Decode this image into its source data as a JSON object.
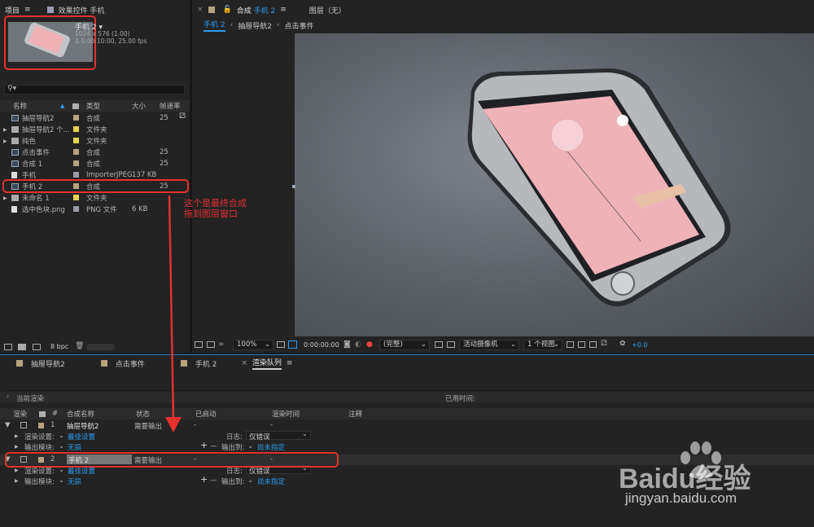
{
  "project_panel": {
    "tab_project": "项目",
    "tab_effects": "效果控件 手机",
    "thumb_name": "手机 2",
    "thumb_size": "1024 x 576 (1.00)",
    "thumb_time": "Δ 0:00:10:00, 25.00 fps",
    "search_placeholder": "",
    "columns": {
      "name": "名称",
      "type": "类型",
      "size": "大小",
      "fps": "帧速率"
    },
    "items": [
      {
        "name": "抽屉导航2",
        "type": "合成",
        "size": "",
        "fps": "25",
        "kind": "comp",
        "color": "#b7a27f"
      },
      {
        "name": "抽屉导航2 个...",
        "type": "文件夹",
        "size": "",
        "fps": "",
        "kind": "folder",
        "color": "#e3d44f"
      },
      {
        "name": "纯色",
        "type": "文件夹",
        "size": "",
        "fps": "",
        "kind": "folder",
        "color": "#e3d44f"
      },
      {
        "name": "点击事件",
        "type": "合成",
        "size": "",
        "fps": "25",
        "kind": "comp",
        "color": "#b7a27f"
      },
      {
        "name": "合成 1",
        "type": "合成",
        "size": "",
        "fps": "25",
        "kind": "comp",
        "color": "#b7a27f"
      },
      {
        "name": "手机",
        "type": "ImporterJPEG",
        "size": "137 KB",
        "fps": "",
        "kind": "file",
        "color": "#9a9aa8"
      },
      {
        "name": "手机 2",
        "type": "合成",
        "size": "",
        "fps": "25",
        "kind": "comp",
        "color": "#b7a27f"
      },
      {
        "name": "未命名 1",
        "type": "文件夹",
        "size": "",
        "fps": "",
        "kind": "folder",
        "color": "#e3d44f"
      },
      {
        "name": "选中色块.png",
        "type": "PNG 文件",
        "size": "6 KB",
        "fps": "",
        "kind": "file",
        "color": "#9a9aa8"
      }
    ],
    "bpc": "8 bpc"
  },
  "comp_panel": {
    "tab_comp_prefix": "合成",
    "tab_comp_name": "手机 2",
    "tab_layer": "图层（无）",
    "breadcrumbs": [
      "手机 2",
      "抽屉导航2",
      "点击事件"
    ],
    "zoom": "100%",
    "timecode": "0:00:00:00",
    "resolution": "(完整)",
    "camera": "活动摄像机",
    "views": "1 个视图",
    "exposure": "+0.0"
  },
  "annotation": {
    "line1": "这个是最终合成",
    "line2": "拖到图层窗口"
  },
  "bottom_tabs": [
    "抽屉导航2",
    "点击事件",
    "手机 2",
    "渲染队列"
  ],
  "render_queue": {
    "current_render": "当前渲染",
    "elapsed": "已用时间:",
    "columns": {
      "render": "渲染",
      "num": "#",
      "comp": "合成名称",
      "status": "状态",
      "started": "已启动",
      "time": "渲染时间",
      "comment": "注释"
    },
    "items": [
      {
        "num": "1",
        "comp": "抽屉导航2",
        "status": "需要输出",
        "started": "-",
        "time": "-",
        "settings_label": "渲染设置:",
        "settings_value": "最佳设置",
        "log_label": "日志:",
        "log_value": "仅错误",
        "module_label": "输出模块:",
        "module_value": "无损",
        "output_label": "输出到:",
        "output_value": "尚未指定"
      },
      {
        "num": "2",
        "comp": "手机 2",
        "status": "需要输出",
        "started": "-",
        "time": "-",
        "settings_label": "渲染设置:",
        "settings_value": "最佳设置",
        "log_label": "日志:",
        "log_value": "仅错误",
        "module_label": "输出模块:",
        "module_value": "无损",
        "output_label": "输出到:",
        "output_value": "尚未指定"
      }
    ]
  },
  "watermark": {
    "brand": "Baidu经验",
    "url": "jingyan.baidu.com"
  }
}
